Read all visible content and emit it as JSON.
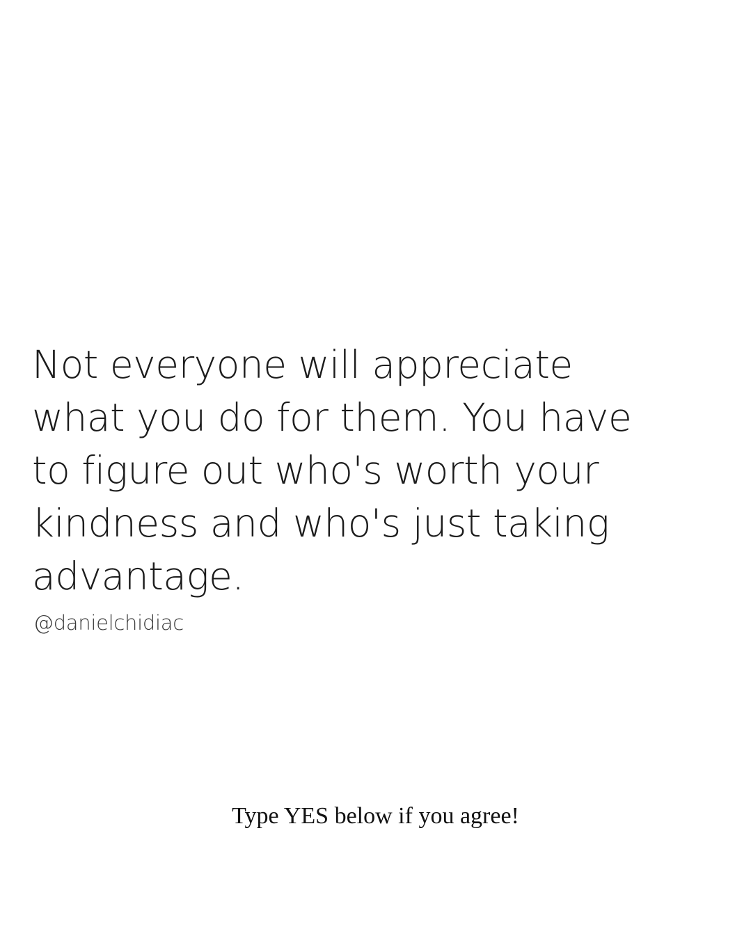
{
  "quote": {
    "lines": [
      "Not everyone will appreciate",
      "what you do for them. You have",
      "to figure out who's worth your",
      "kindness and who's just taking",
      "advantage."
    ]
  },
  "author_handle": "@danielchidiac",
  "call_to_action": "Type YES below if you agree!",
  "colors": {
    "background": "#ffffff",
    "text": "#1c1c1c"
  }
}
